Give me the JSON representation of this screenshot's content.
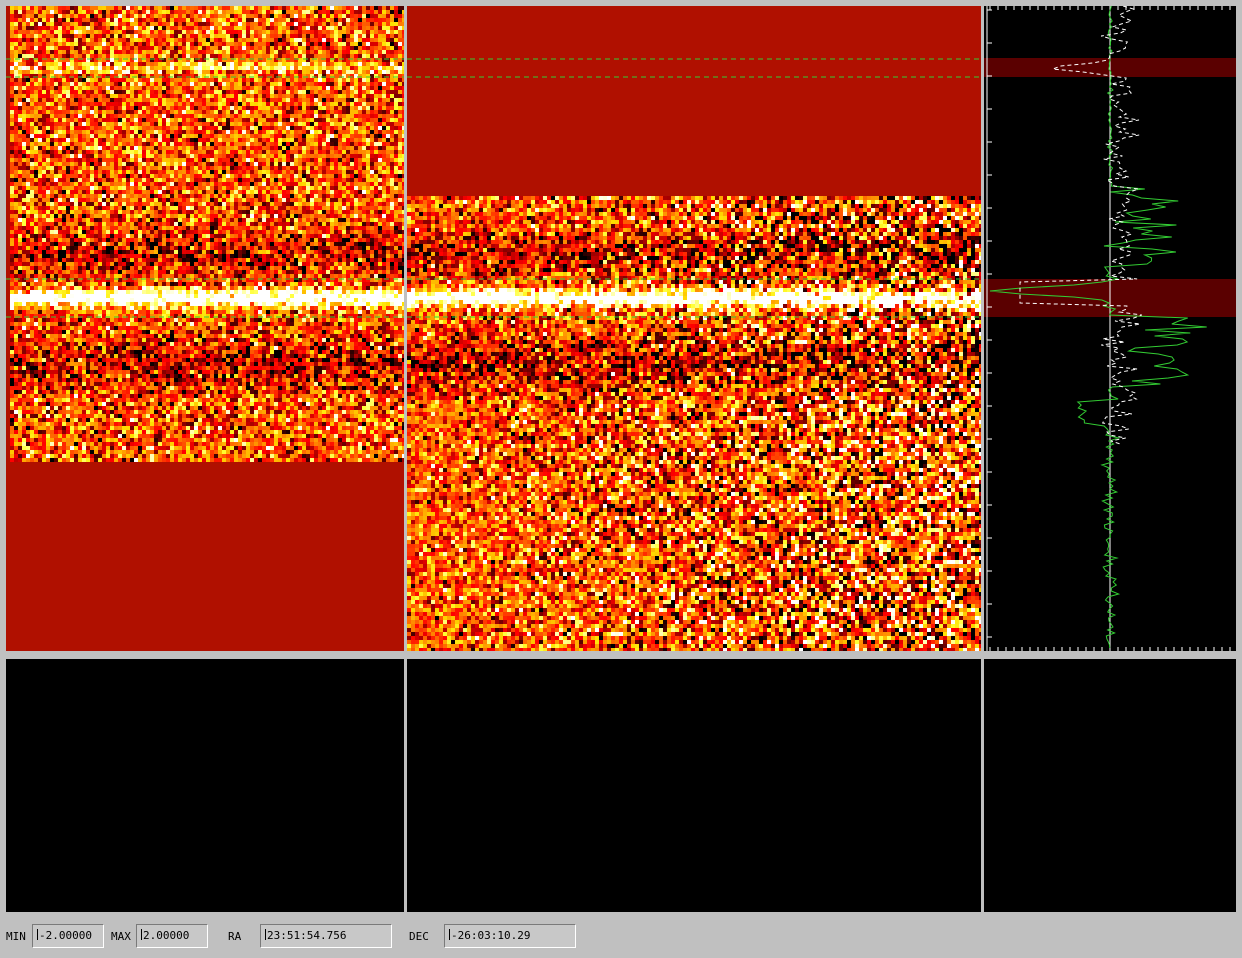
{
  "statusbar": {
    "min_label": "MIN",
    "min_value": "-2.00000",
    "max_label": "MAX",
    "max_value": "2.00000",
    "ra_label": "RA",
    "ra_value": "23:51:54.756",
    "dec_label": "DEC",
    "dec_value": "-26:03:10.29"
  },
  "colors": {
    "background": "#c0c0c0",
    "fill_red": "#b01000",
    "band_dark": "#5a0000",
    "trace_solid": "#33cc33",
    "trace_dashed": "#ffffff",
    "marker_line": "#33cc33"
  },
  "images": {
    "left": {
      "name": "left-image-panel",
      "colormap": "heat"
    },
    "middle": {
      "name": "middle-image-panel",
      "colormap": "heat"
    },
    "spectrum": {
      "name": "spatial-profile-panel"
    }
  }
}
